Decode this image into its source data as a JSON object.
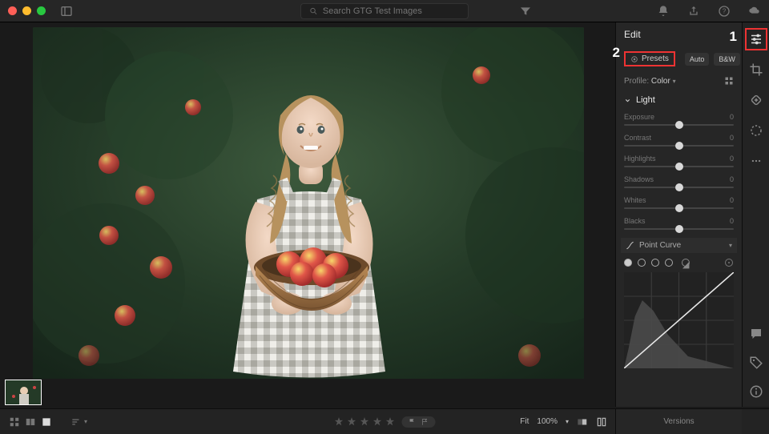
{
  "search": {
    "placeholder": "Search GTG Test Images"
  },
  "edit": {
    "title": "Edit",
    "presets": "Presets",
    "auto": "Auto",
    "bw": "B&W",
    "profile_label": "Profile:",
    "profile_value": "Color",
    "light_section": "Light",
    "sliders": [
      {
        "label": "Exposure",
        "value": "0"
      },
      {
        "label": "Contrast",
        "value": "0"
      },
      {
        "label": "Highlights",
        "value": "0"
      },
      {
        "label": "Shadows",
        "value": "0"
      },
      {
        "label": "Whites",
        "value": "0"
      },
      {
        "label": "Blacks",
        "value": "0"
      }
    ],
    "point_curve": "Point Curve"
  },
  "bottom": {
    "fit": "Fit",
    "zoom": "100%"
  },
  "versions": "Versions",
  "annotations": {
    "one": "1",
    "two": "2"
  }
}
